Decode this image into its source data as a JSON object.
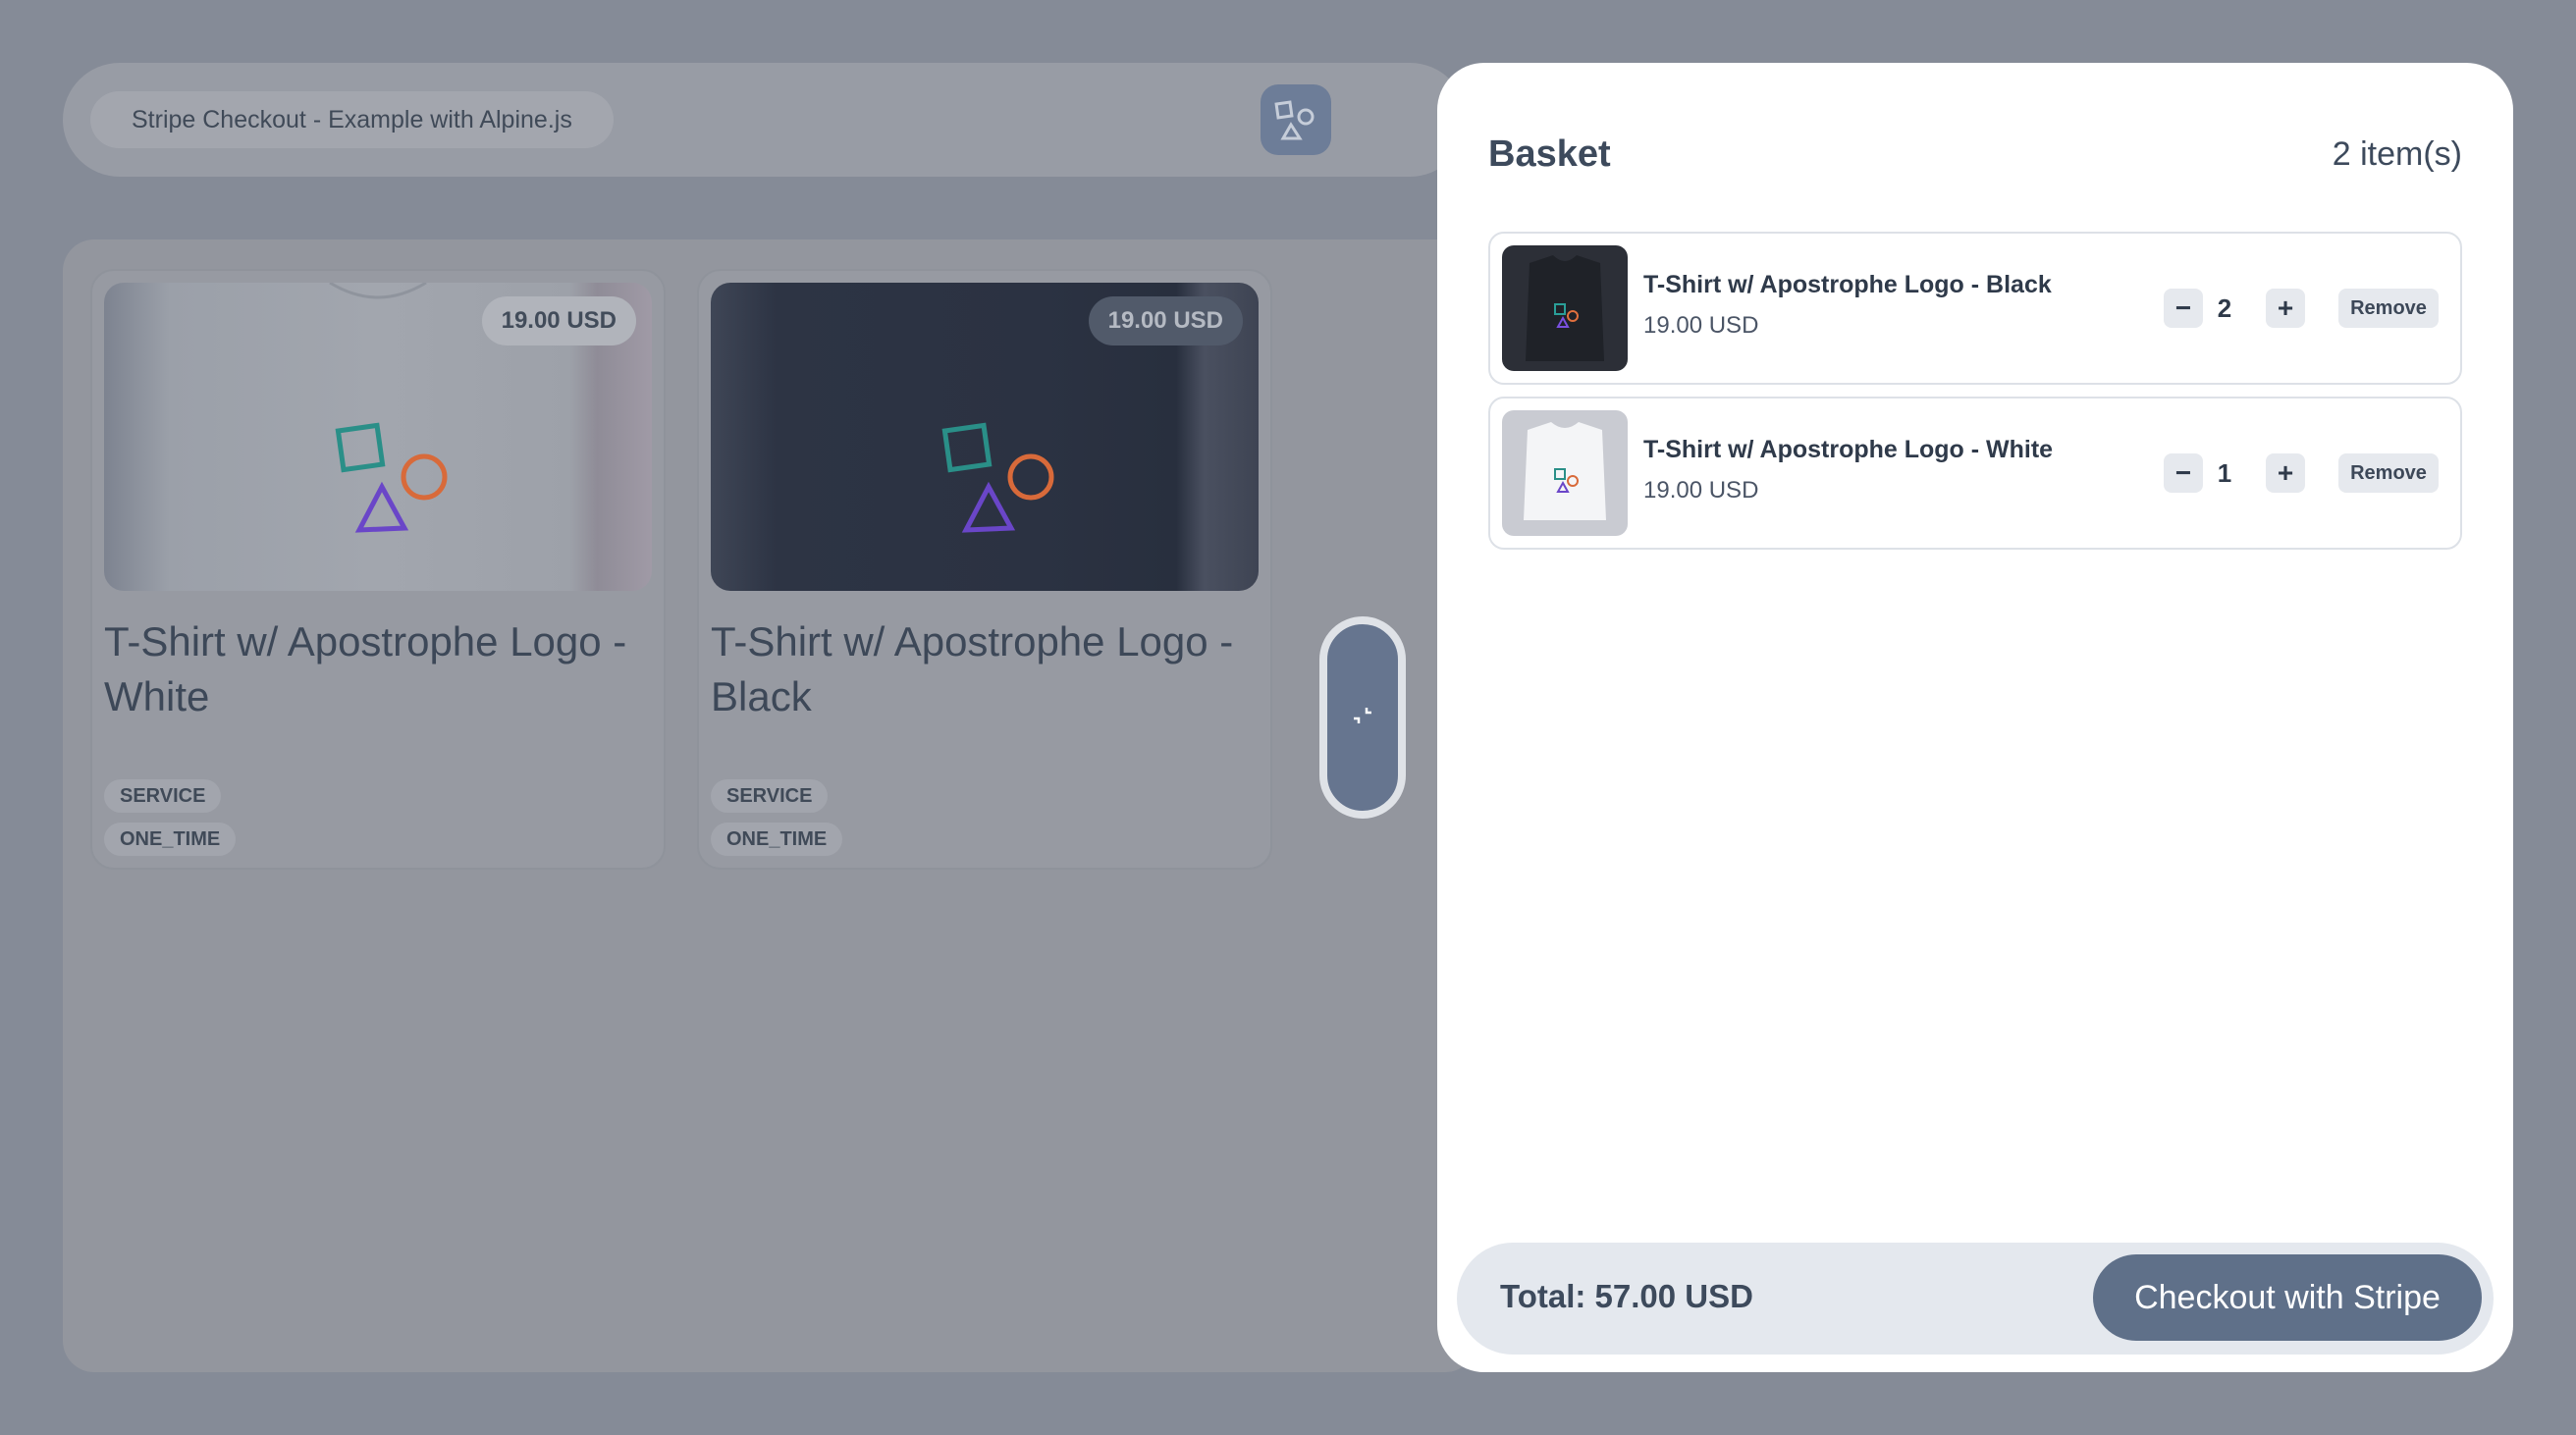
{
  "header": {
    "app_title": "Stripe Checkout - Example with Alpine.js",
    "logo_icon": "shapes-logo-icon"
  },
  "products": [
    {
      "name": "T-Shirt w/ Apostrophe Logo - White",
      "price": "19.00 USD",
      "variant": "white",
      "tags": [
        "SERVICE",
        "ONE_TIME"
      ]
    },
    {
      "name": "T-Shirt w/ Apostrophe Logo - Black",
      "price": "19.00 USD",
      "variant": "black",
      "tags": [
        "SERVICE",
        "ONE_TIME"
      ]
    }
  ],
  "drawer_handle": {
    "icon": "collapse-icon"
  },
  "basket": {
    "title": "Basket",
    "count": "2 item(s)",
    "items": [
      {
        "name": "T-Shirt w/ Apostrophe Logo - Black",
        "price": "19.00 USD",
        "quantity": "2",
        "minus": "−",
        "plus": "+",
        "remove_label": "Remove"
      },
      {
        "name": "T-Shirt w/ Apostrophe Logo - White",
        "price": "19.00 USD",
        "quantity": "1",
        "minus": "−",
        "plus": "+",
        "remove_label": "Remove"
      }
    ],
    "total": "Total: 57.00 USD",
    "checkout_label": "Checkout with Stripe"
  },
  "colors": {
    "backdrop": "#858b97",
    "accent": "#5f7089",
    "drawer": "#ffffff"
  }
}
